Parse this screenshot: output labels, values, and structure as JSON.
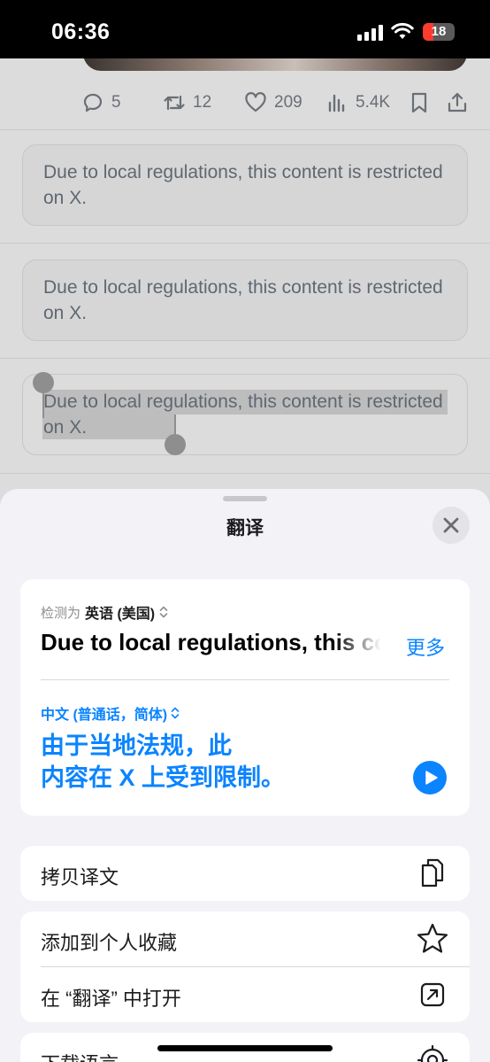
{
  "status_bar": {
    "time": "06:36",
    "battery": "18",
    "battery_level": 0.18,
    "battery_color": "#ff3b30"
  },
  "post_actions": {
    "replies": "5",
    "reposts": "12",
    "likes": "209",
    "views": "5.4K"
  },
  "restricted_notices": [
    "Due to local regulations, this content is restricted on X.",
    "Due to local regulations, this content is restricted on X.",
    "Due to local regulations, this content is restricted on X."
  ],
  "sheet": {
    "title": "翻译",
    "detect_label": "检测为",
    "source_language": "英语 (美国)",
    "source_text": "Due to local regulations, this content is restricted on X.",
    "more_label": "更多",
    "target_language": "中文 (普通话，简体)",
    "target_text": "由于当地法规，此\n内容在 X 上受到限制。",
    "actions": {
      "copy": "拷贝译文",
      "favorite": "添加到个人收藏",
      "open_in_app": "在 “翻译” 中打开",
      "download": "下载语言"
    }
  },
  "colors": {
    "accent": "#0a84ff",
    "sheet_background": "#f2f2f7"
  },
  "icons": [
    "reply-icon",
    "repost-icon",
    "like-icon",
    "views-icon",
    "bookmark-icon",
    "share-icon",
    "close-icon",
    "chevron-updown-icon",
    "play-icon",
    "copy-icon",
    "star-icon",
    "open-external-icon",
    "download-settings-icon"
  ]
}
